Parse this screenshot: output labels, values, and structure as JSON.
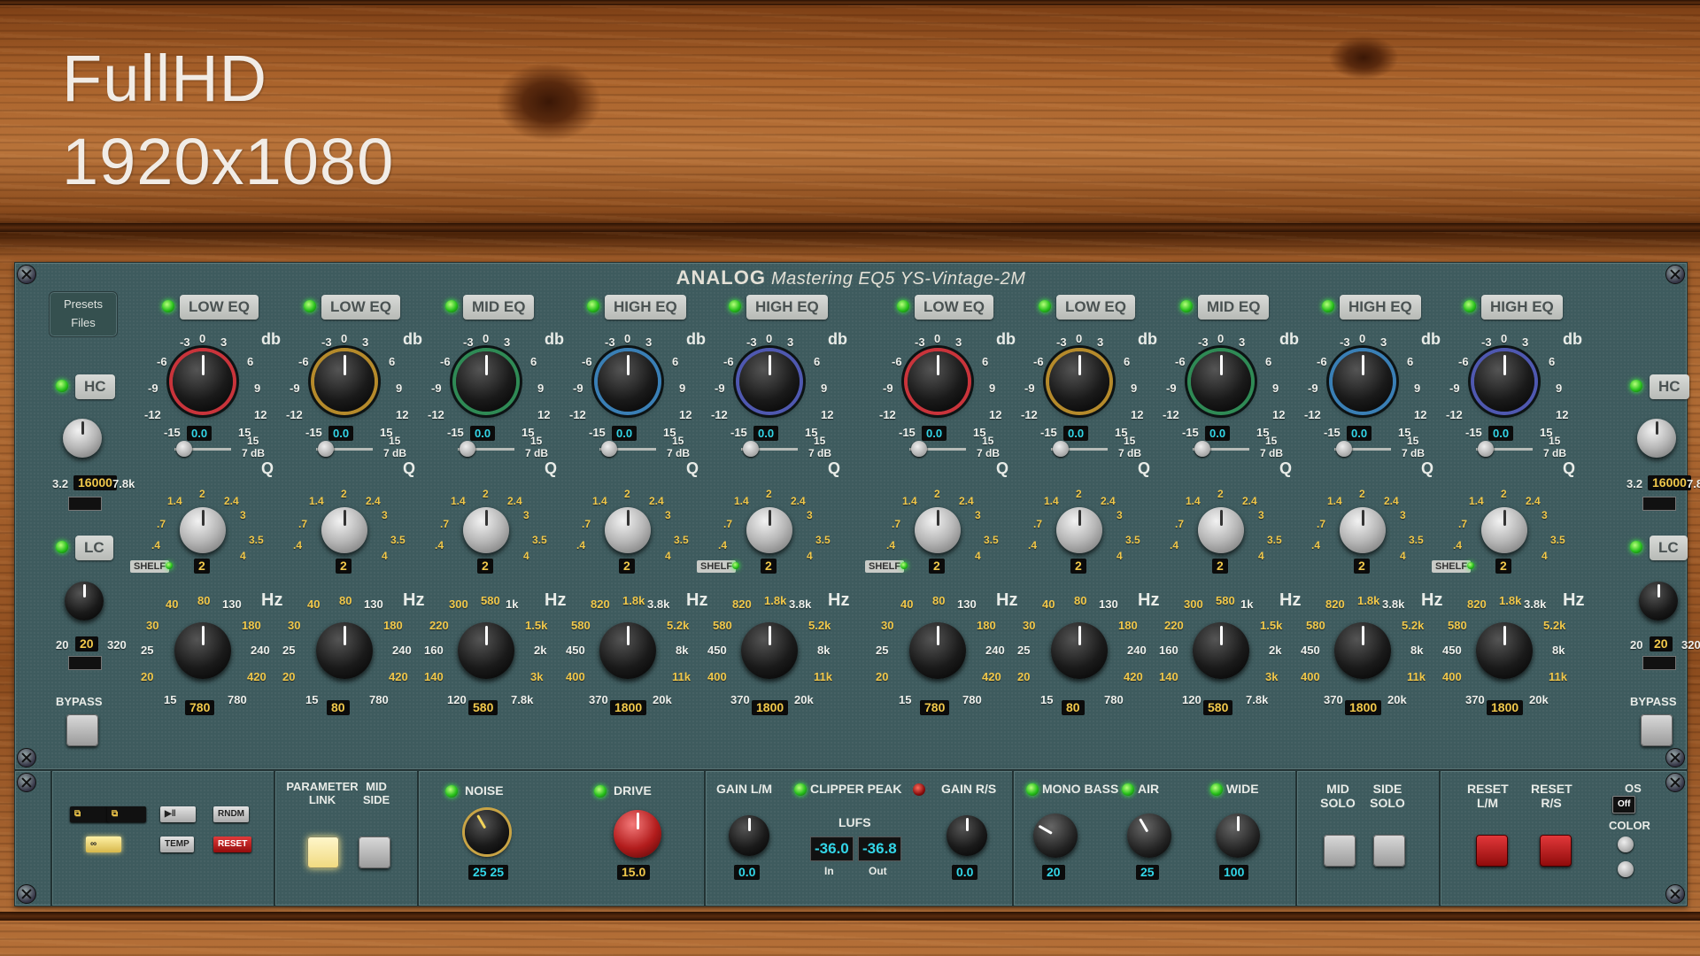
{
  "overlay": {
    "line1": "FullHD",
    "line2": "1920x1080"
  },
  "header": {
    "brand": "ANALOG",
    "model": "Mastering EQ5 YS-Vintage-2M"
  },
  "presets": {
    "presets_label": "Presets",
    "files_label": "Files"
  },
  "side": {
    "hc_label": "HC",
    "lc_label": "LC",
    "bypass_label": "BYPASS",
    "hc_min": "3.2",
    "hc_value": "16000",
    "hc_max": "7.8k",
    "lc_min": "20",
    "lc_value": "20",
    "lc_max": "320"
  },
  "bands": [
    {
      "label": "LOW EQ",
      "ring": "#c9343b",
      "freq": "780",
      "q": "2",
      "shelf": true,
      "hz": [
        "40",
        "80",
        "130",
        "30",
        "180",
        "25",
        "240",
        "20",
        "420",
        "15",
        "780"
      ]
    },
    {
      "label": "LOW EQ",
      "ring": "#b58a2b",
      "freq": "80",
      "q": "2",
      "shelf": false,
      "hz": [
        "40",
        "80",
        "130",
        "30",
        "180",
        "25",
        "240",
        "20",
        "420",
        "15",
        "780"
      ]
    },
    {
      "label": "MID EQ",
      "ring": "#2f8a55",
      "freq": "580",
      "q": "2",
      "shelf": false,
      "hz": [
        "300",
        "580",
        "1k",
        "220",
        "1.5k",
        "160",
        "2k",
        "140",
        "3k",
        "120",
        "7.8k"
      ]
    },
    {
      "label": "HIGH EQ",
      "ring": "#3a7fb5",
      "freq": "1800",
      "q": "2",
      "shelf": false,
      "hz": [
        "820",
        "1.8k",
        "3.8k",
        "580",
        "5.2k",
        "450",
        "8k",
        "400",
        "11k",
        "370",
        "20k"
      ]
    },
    {
      "label": "HIGH EQ",
      "ring": "#4f58b0",
      "freq": "1800",
      "q": "2",
      "shelf": true,
      "hz": [
        "820",
        "1.8k",
        "3.8k",
        "580",
        "5.2k",
        "450",
        "8k",
        "400",
        "11k",
        "370",
        "20k"
      ]
    }
  ],
  "gain_scale": [
    "-3",
    "0",
    "3",
    "-6",
    "6",
    "-9",
    "9",
    "-12",
    "12",
    "-15",
    "15"
  ],
  "gain_value": "0.0",
  "gain_unit": "db",
  "range_label_top": "15",
  "range_label_bottom": "7 dB",
  "q_unit": "Q",
  "q_scale": [
    "1.4",
    "2",
    "2.4",
    ".7",
    "3",
    "3.5",
    ".4",
    "4"
  ],
  "hz_unit": "Hz",
  "shelf_label": "SHELF",
  "bottom": {
    "param_link": "PARAMETER LINK",
    "mid_side": "MID SIDE",
    "noise_label": "NOISE",
    "noise_value": "25 25",
    "drive_label": "DRIVE",
    "drive_value": "15.0",
    "gain_lm_label": "GAIN L/M",
    "gain_lm_value": "0.0",
    "clipper_label": "CLIPPER PEAK",
    "lufs_label": "LUFS",
    "lufs_in": "-36.0",
    "lufs_out": "-36.8",
    "in_label": "In",
    "out_label": "Out",
    "gain_rs_label": "GAIN R/S",
    "gain_rs_value": "0.0",
    "mono_bass_label": "MONO BASS",
    "mono_bass_value": "20",
    "air_label": "AIR",
    "air_value": "25",
    "wide_label": "WIDE",
    "wide_value": "100",
    "mid_solo": "MID SOLO",
    "side_solo": "SIDE SOLO",
    "reset_lm": "RESET L/M",
    "reset_rs": "RESET R/S",
    "os_label": "OS",
    "os_value": "Off",
    "color_label": "COLOR",
    "rndm": "RNDM",
    "temp": "TEMP",
    "reset": "RESET"
  }
}
